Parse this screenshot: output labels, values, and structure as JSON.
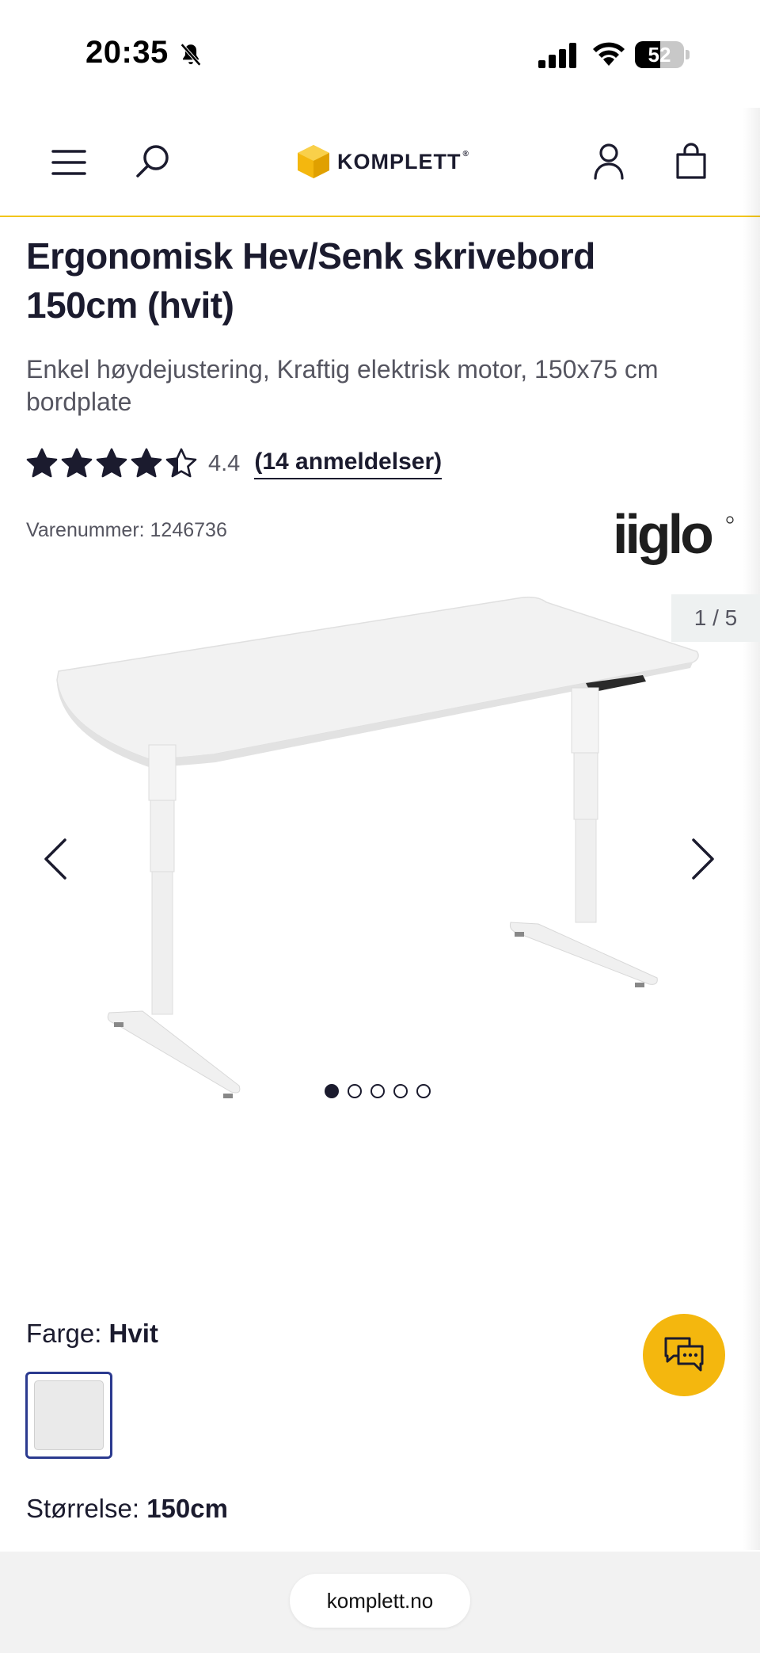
{
  "status_bar": {
    "time": "20:35",
    "battery_level": "52",
    "battery_fraction": 0.52
  },
  "header": {
    "logo_text": "KOMPLETT",
    "logo_mark": "®",
    "icons": [
      "menu-icon",
      "search-icon",
      "account-icon",
      "cart-icon"
    ]
  },
  "product": {
    "title": "Ergonomisk Hev/Senk skrivebord 150cm (hvit)",
    "description": "Enkel høydejustering, Kraftig elektrisk motor, 150x75 cm bordplate",
    "rating_value": "4.4",
    "rating_fraction": 0.88,
    "reviews_link": "(14 anmeldelser)",
    "sku": "Varenummer: 1246736",
    "brand": "iiglo"
  },
  "gallery": {
    "counter": "1 / 5",
    "current_index": 1,
    "total_images": 5
  },
  "options": {
    "color_prefix": "Farge:",
    "color_value": "Hvit",
    "swatch_color": "#eaeaea",
    "size_prefix": "Størrelse:",
    "size_value": "150cm"
  },
  "browser": {
    "url": "komplett.no"
  },
  "colors": {
    "accent_yellow": "#f4b70e",
    "header_rule": "#f2c51b",
    "text_dark": "#1b1b2e",
    "swatch_border": "#2b3a8f"
  }
}
